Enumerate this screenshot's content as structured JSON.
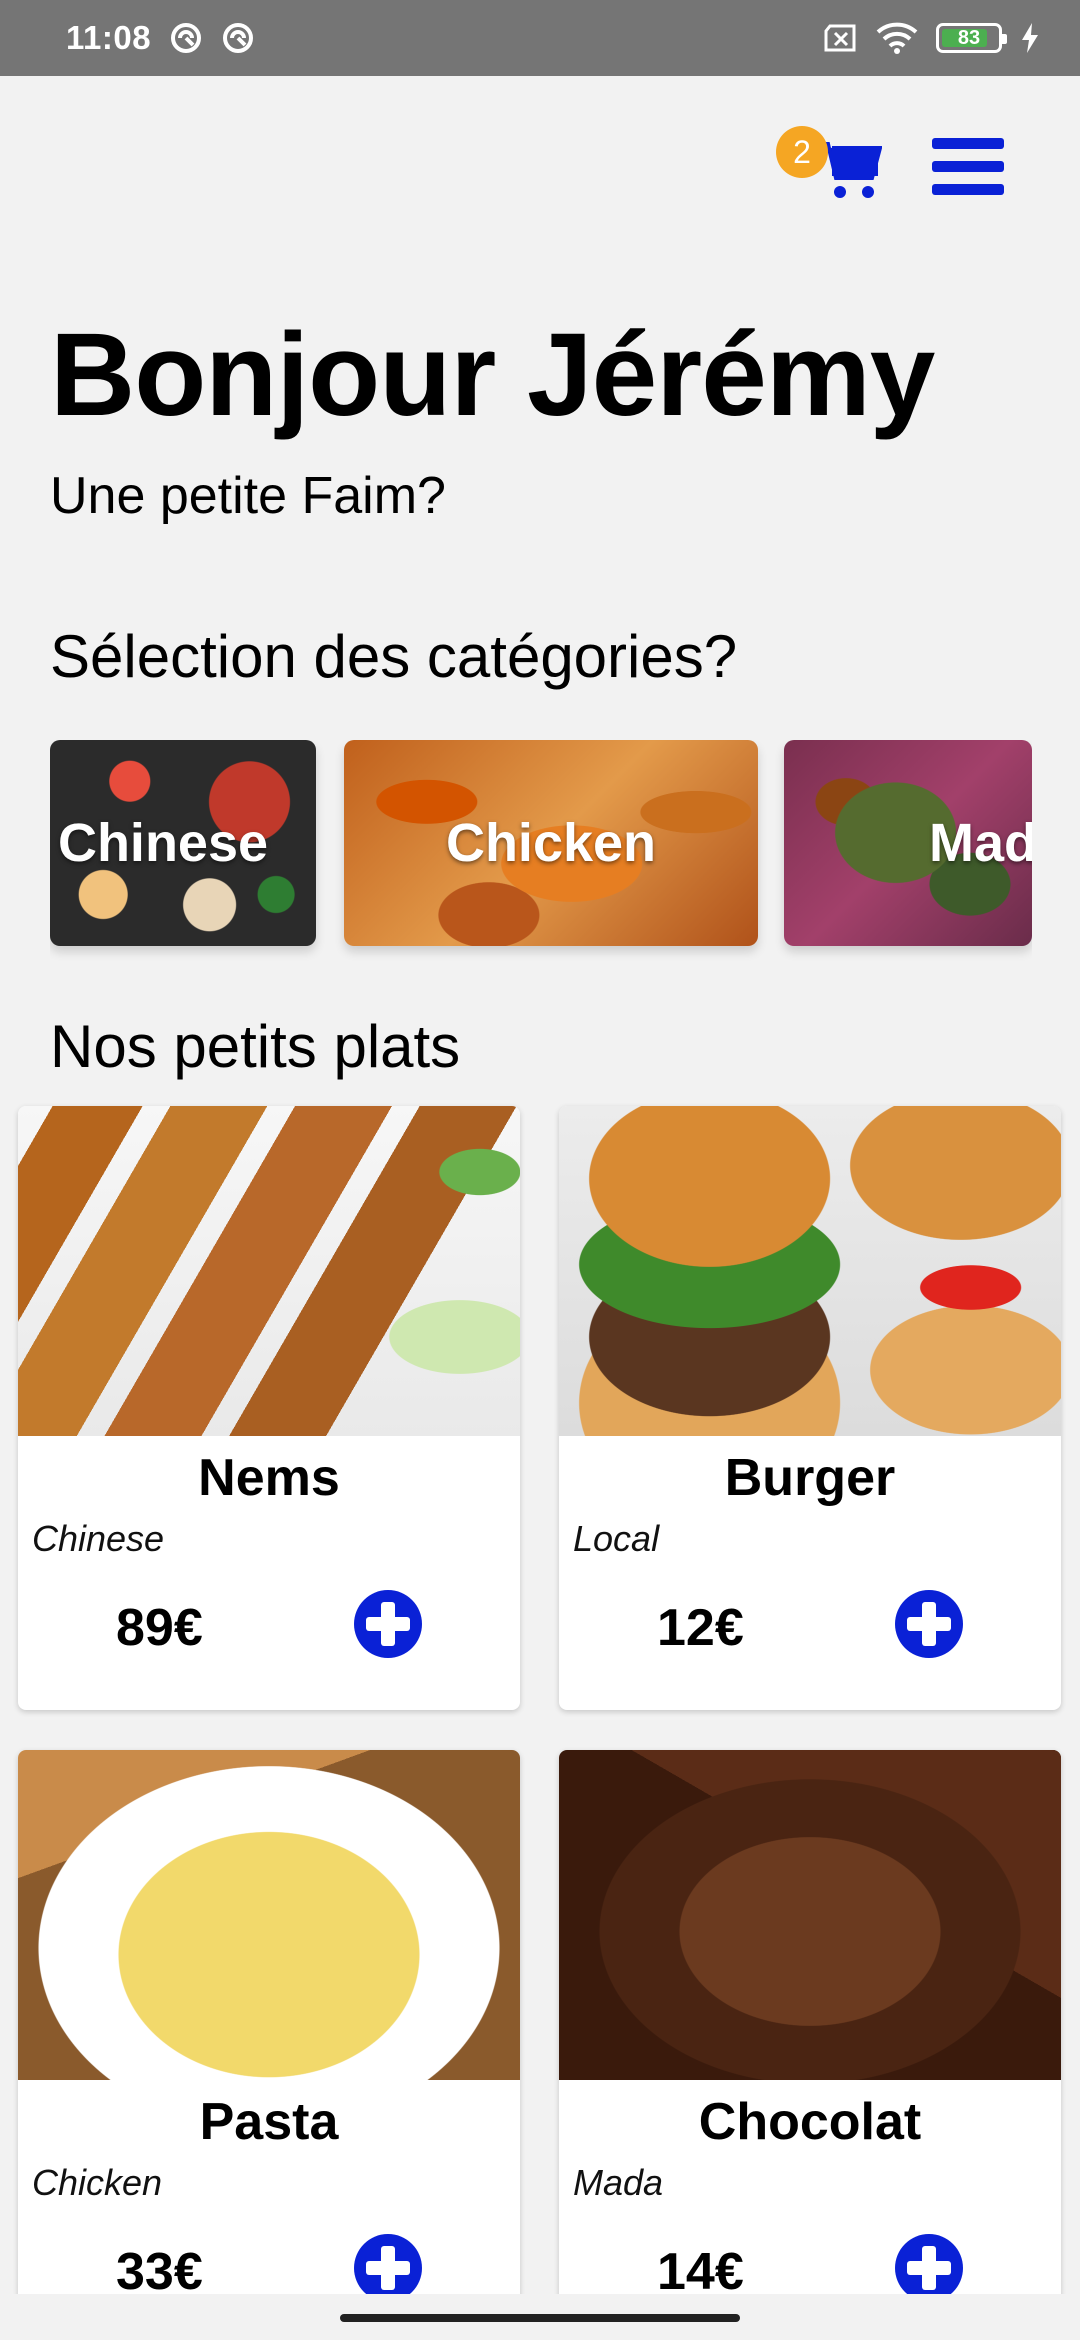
{
  "status_bar": {
    "time": "11:08",
    "battery": "83",
    "battery_level": 0.83
  },
  "header": {
    "cart_count": "2",
    "accent_color": "#0a21d6",
    "badge_color": "#f5a623"
  },
  "greeting": "Bonjour Jérémy",
  "subtitle": "Une petite Faim?",
  "categories_title": "Sélection des catégories?",
  "categories": [
    {
      "label": "Chinese"
    },
    {
      "label": "Chicken"
    },
    {
      "label": "Mad"
    }
  ],
  "dishes_title": "Nos petits plats",
  "dishes": [
    {
      "name": "Nems",
      "category": "Chinese",
      "price": "89€"
    },
    {
      "name": "Burger",
      "category": "Local",
      "price": "12€"
    },
    {
      "name": "Pasta",
      "category": "Chicken",
      "price": "33€"
    },
    {
      "name": "Chocolat",
      "category": "Mada",
      "price": "14€"
    }
  ]
}
